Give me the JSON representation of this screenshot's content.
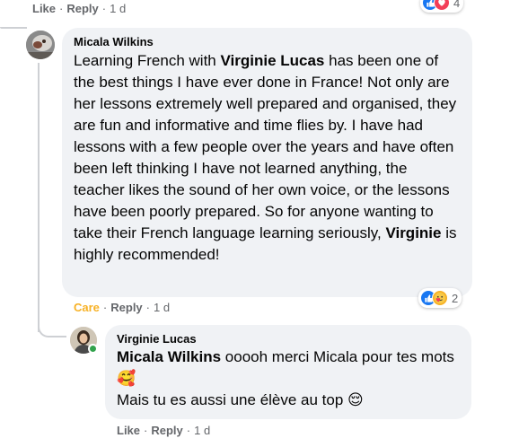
{
  "top_comment": {
    "actions": {
      "like": "Like",
      "reply": "Reply",
      "time": "1 d"
    },
    "reaction_count": "4"
  },
  "comment": {
    "author": "Micala Wilkins",
    "text_segments": [
      {
        "t": "Learning French with ",
        "b": false
      },
      {
        "t": "Virginie Lucas",
        "b": true
      },
      {
        "t": " has been one of the best things I have ever done in France! Not only are her lessons extremely well prepared and organised, they are fun and informative and time flies by. I have had lessons with a few people over the years and have often been left thinking I have not learned anything, the teacher likes the sound of her own voice, or the lessons have been poorly prepared. So for anyone wanting to take their French language learning seriously, ",
        "b": false
      },
      {
        "t": "Virginie",
        "b": true
      },
      {
        "t": " is highly recommended!",
        "b": false
      }
    ],
    "actions": {
      "care": "Care",
      "reply": "Reply",
      "time": "1 d"
    },
    "reactions": [
      "like-icon",
      "care-icon"
    ],
    "reaction_count": "2"
  },
  "reply": {
    "author": "Virginie Lucas",
    "mention": "Micala Wilkins",
    "line1_rest": " ooooh merci Micala pour tes mots ",
    "line1_emoji": "🥰",
    "line2": "Mais tu es aussi une élève au top ",
    "line2_emoji": "😌",
    "actions": {
      "like": "Like",
      "reply": "Reply",
      "time": "1 d"
    }
  },
  "colors": {
    "bubble": "#f0f2f5",
    "meta_text": "#65676b",
    "care": "#f7b125",
    "like_blue": "#1877f2",
    "love_red": "#f33e58",
    "online_green": "#31a24c"
  }
}
